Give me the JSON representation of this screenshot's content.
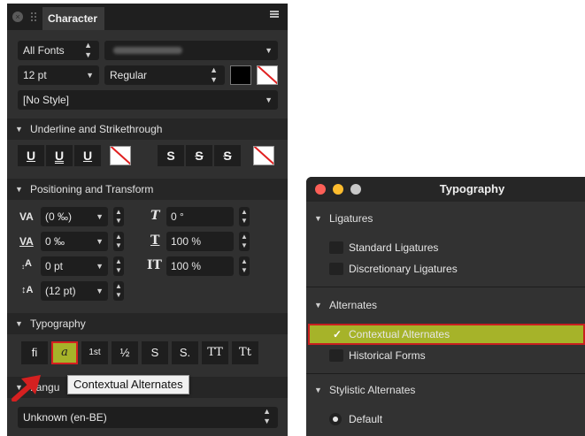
{
  "character_panel": {
    "tab_title": "Character",
    "font_collection": "All Fonts",
    "font_size": "12 pt",
    "font_weight": "Regular",
    "style": "[No Style]",
    "sections": {
      "underline": "Underline and Strikethrough",
      "positioning": "Positioning and Transform",
      "typography": "Typography",
      "language": "Langu"
    },
    "underline_buttons": [
      "U",
      "U",
      "U",
      "S",
      "S",
      "S"
    ],
    "positioning": {
      "tracking": "(0 ‰)",
      "kerning": "0 ‰",
      "baseline": "0 pt",
      "leading": "(12 pt)",
      "shear": "0 °",
      "hscale": "100 %",
      "vscale": "100 %",
      "icons": {
        "tracking": "VA",
        "kerning": "VA",
        "baseline": "A",
        "leading": "A",
        "shear": "T",
        "hscale": "T",
        "vscale": "IT"
      }
    },
    "typography_buttons": [
      "fi",
      "a",
      "1st",
      "½",
      "S",
      "S.",
      "TT",
      "Tt"
    ],
    "tooltip": "Contextual Alternates",
    "language_value": "Unknown (en-BE)"
  },
  "typography_window": {
    "title": "Typography",
    "ligatures_header": "Ligatures",
    "ligatures": [
      "Standard Ligatures",
      "Discretionary Ligatures"
    ],
    "alternates_header": "Alternates",
    "alternates": [
      "Contextual Alternates",
      "Historical Forms"
    ],
    "checkmark": "✓",
    "stylistic_header": "Stylistic Alternates",
    "stylistic_options": [
      "Default"
    ]
  },
  "colors": {
    "panel_bg": "#303030",
    "highlight": "#a6b329",
    "red_outline": "#d52020",
    "traffic_close": "#fc5f57",
    "traffic_min": "#fdbc2e",
    "traffic_max": "#c8c8c8"
  }
}
